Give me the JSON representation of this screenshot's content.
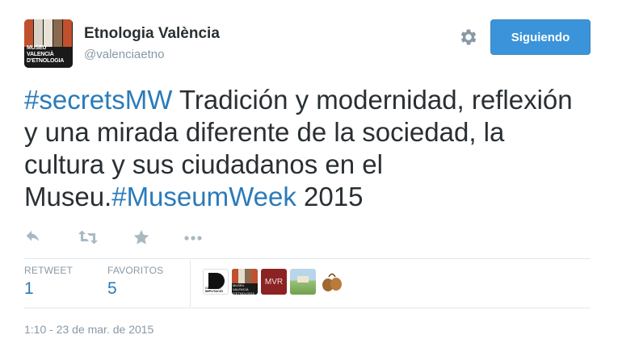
{
  "account": {
    "full_name": "Etnologia València",
    "screen_name": "@valenciaetno",
    "avatar_caption_line1": "MUSEU VALENCIÀ",
    "avatar_caption_line2": "D'ETNOLOGIA"
  },
  "header": {
    "settings_icon": "gear-icon",
    "follow_button_label": "Siguiendo"
  },
  "tweet": {
    "hashtag_1": "#secretsMW",
    "text_part_1": " Tradición y modernidad, reflexión y una mirada diferente de la sociedad, la cultura y sus ciudadanos en el Museu.",
    "hashtag_2": "#MuseumWeek",
    "text_part_2": " 2015"
  },
  "actions": {
    "reply_icon": "reply-icon",
    "retweet_icon": "retweet-icon",
    "favorite_icon": "star-icon",
    "more_icon": "more-dots-icon"
  },
  "stats": {
    "retweets_label": "RETWEET",
    "retweets_value": "1",
    "favorites_label": "FAVORITOS",
    "favorites_value": "5"
  },
  "favoriters": {
    "avatar_1_text_line1": "CULTURA",
    "avatar_1_text_line2": "IMPUTACIÓ",
    "avatar_2_text": "MUSEU VALENCIÀ D'ETNOLOGIA",
    "avatar_3_text": "MVR"
  },
  "timestamp": "1:10 - 23 de mar. de 2015",
  "colors": {
    "link": "#2b7bb9",
    "follow_button": "#3b94d9",
    "muted": "#8899a6",
    "text": "#292f33"
  }
}
